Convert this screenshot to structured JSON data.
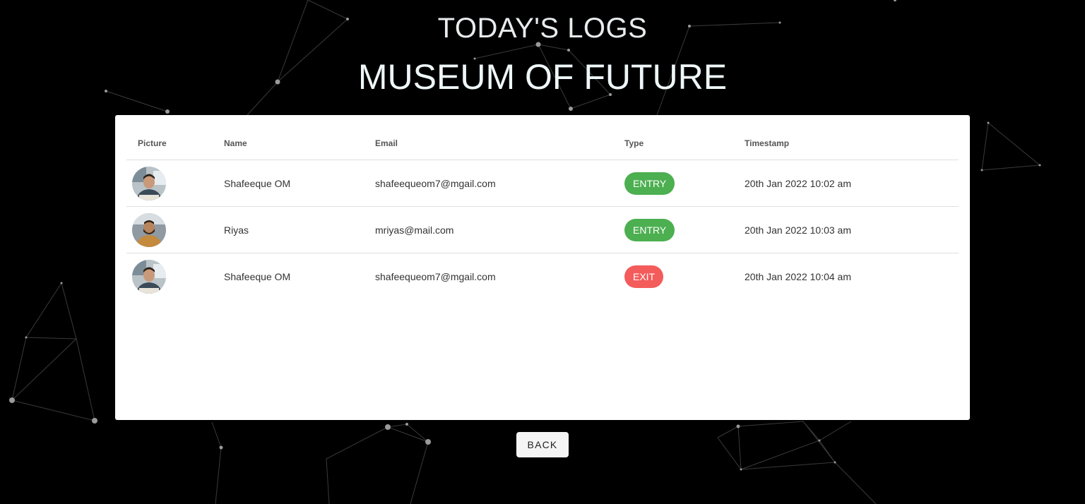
{
  "header": {
    "subtitle": "TODAY'S LOGS",
    "title": "MUSEUM OF FUTURE"
  },
  "table": {
    "columns": [
      "Picture",
      "Name",
      "Email",
      "Type",
      "Timestamp"
    ],
    "rows": [
      {
        "name": "Shafeeque OM",
        "email": "shafeequeom7@mgail.com",
        "type": "ENTRY",
        "type_color": "#4caf50",
        "timestamp": "20th Jan 2022 10:02 am"
      },
      {
        "name": "Riyas",
        "email": "mriyas@mail.com",
        "type": "ENTRY",
        "type_color": "#4caf50",
        "timestamp": "20th Jan 2022 10:03 am"
      },
      {
        "name": "Shafeeque OM",
        "email": "shafeequeom7@mgail.com",
        "type": "EXIT",
        "type_color": "#f45b5b",
        "timestamp": "20th Jan 2022 10:04 am"
      }
    ]
  },
  "actions": {
    "back_label": "BACK"
  },
  "colors": {
    "background": "#000000",
    "entry": "#4caf50",
    "exit": "#f45b5b"
  }
}
